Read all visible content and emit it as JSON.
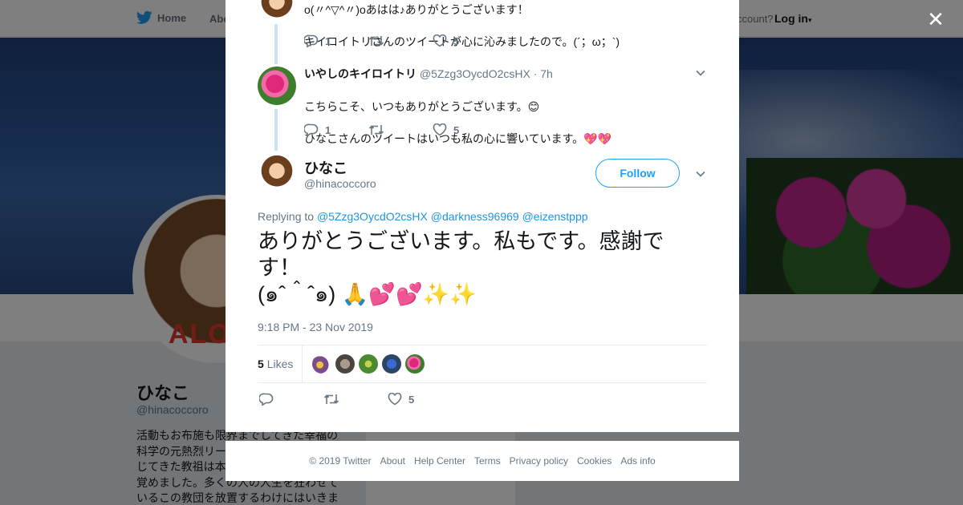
{
  "topnav": {
    "home_label": "Home",
    "about_label": "Abo",
    "account_prompt": "ccount?",
    "login_label": "Log in"
  },
  "profile": {
    "name": "ひなこ",
    "handle": "@hinacoccoro",
    "bio_lines": [
      "活動もお布施も限界までしてきた幸福の",
      "科学の元熱烈リー",
      "じてきた教祖は本",
      "覚めました。多くの人の人生を狂わせて",
      "いるこの教団を放置するわけにはいきま"
    ],
    "ads_ghost": "Ads info"
  },
  "modal": {
    "tweet1": {
      "line1": "o(〃^▽^〃)oあはは♪ありがとうございます！",
      "line2": "キイロイトリさんのツイートが心に沁みましたので。(´；ω；`)",
      "reply_count": "1",
      "like_count": "5"
    },
    "tweet2": {
      "name": "いやしのキイロイトリ",
      "handle": "@5Zzg3OycdO2csHX",
      "time": "· 7h",
      "line1": "こちらこそ、いつもありがとうございます。😊",
      "line2": "ひなこさんのツイートはいつも私の心に響いています。💖💖",
      "reply_count": "1",
      "like_count": "5"
    },
    "main": {
      "name": "ひなこ",
      "handle": "@hinacoccoro",
      "follow_label": "Follow",
      "replying_prefix": "Replying to",
      "mentions": [
        "@5Zzg3OycdO2csHX",
        "@darkness96969",
        "@eizenstppp"
      ],
      "text": "ありがとうございます。私もです。感謝です！\n(๑ˆ＾ˆ๑) 🙏💕💕✨✨",
      "timestamp": "9:18 PM - 23 Nov 2019",
      "likes_count": "5",
      "likes_label": "Likes",
      "like_count_action": "5"
    }
  },
  "footer": {
    "links": [
      "© 2019 Twitter",
      "About",
      "Help Center",
      "Terms",
      "Privacy policy",
      "Cookies",
      "Ads info"
    ]
  },
  "colors": {
    "accent": "#1da1f2",
    "link": "#1b95e0",
    "muted": "#657786",
    "thread": "#cce2f6"
  }
}
